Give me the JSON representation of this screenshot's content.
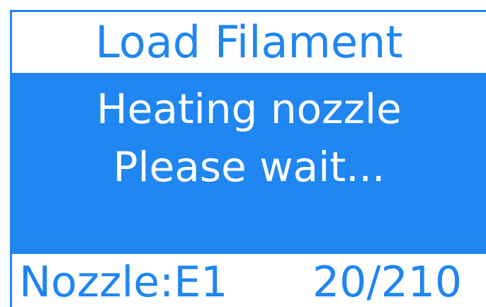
{
  "screen": {
    "title": "Load Filament",
    "message": {
      "line1": "Heating nozzle",
      "line2": "Please wait..."
    },
    "footer": {
      "nozzle_label": "Nozzle:E1",
      "temperature": "20/210"
    }
  },
  "colors": {
    "accent": "#1f86f2",
    "text_on_accent": "#ffffff",
    "background": "#ffffff"
  }
}
